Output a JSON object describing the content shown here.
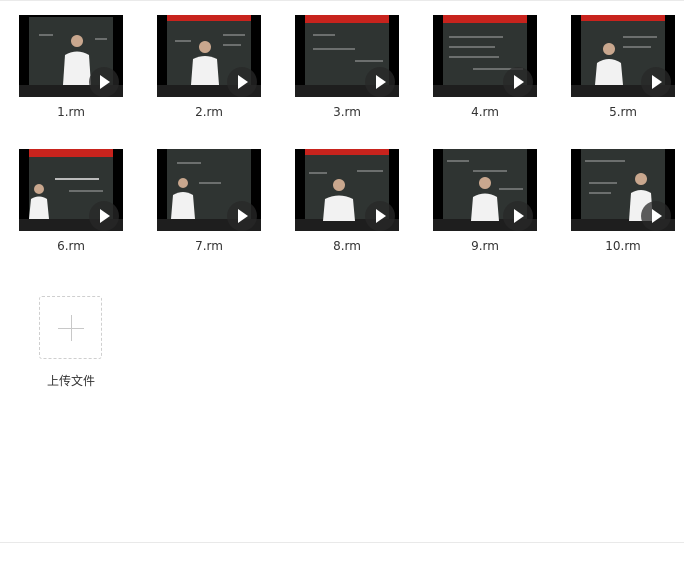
{
  "files": [
    {
      "name": "1.rm"
    },
    {
      "name": "2.rm"
    },
    {
      "name": "3.rm"
    },
    {
      "name": "4.rm"
    },
    {
      "name": "5.rm"
    },
    {
      "name": "6.rm"
    },
    {
      "name": "7.rm"
    },
    {
      "name": "8.rm"
    },
    {
      "name": "9.rm"
    },
    {
      "name": "10.rm"
    }
  ],
  "upload": {
    "label": "上传文件"
  },
  "colors": {
    "chalkboard": "#2f3432",
    "banner": "#c8231d",
    "shirt": "#f2f2f2",
    "audience": "#1e1e1e"
  }
}
